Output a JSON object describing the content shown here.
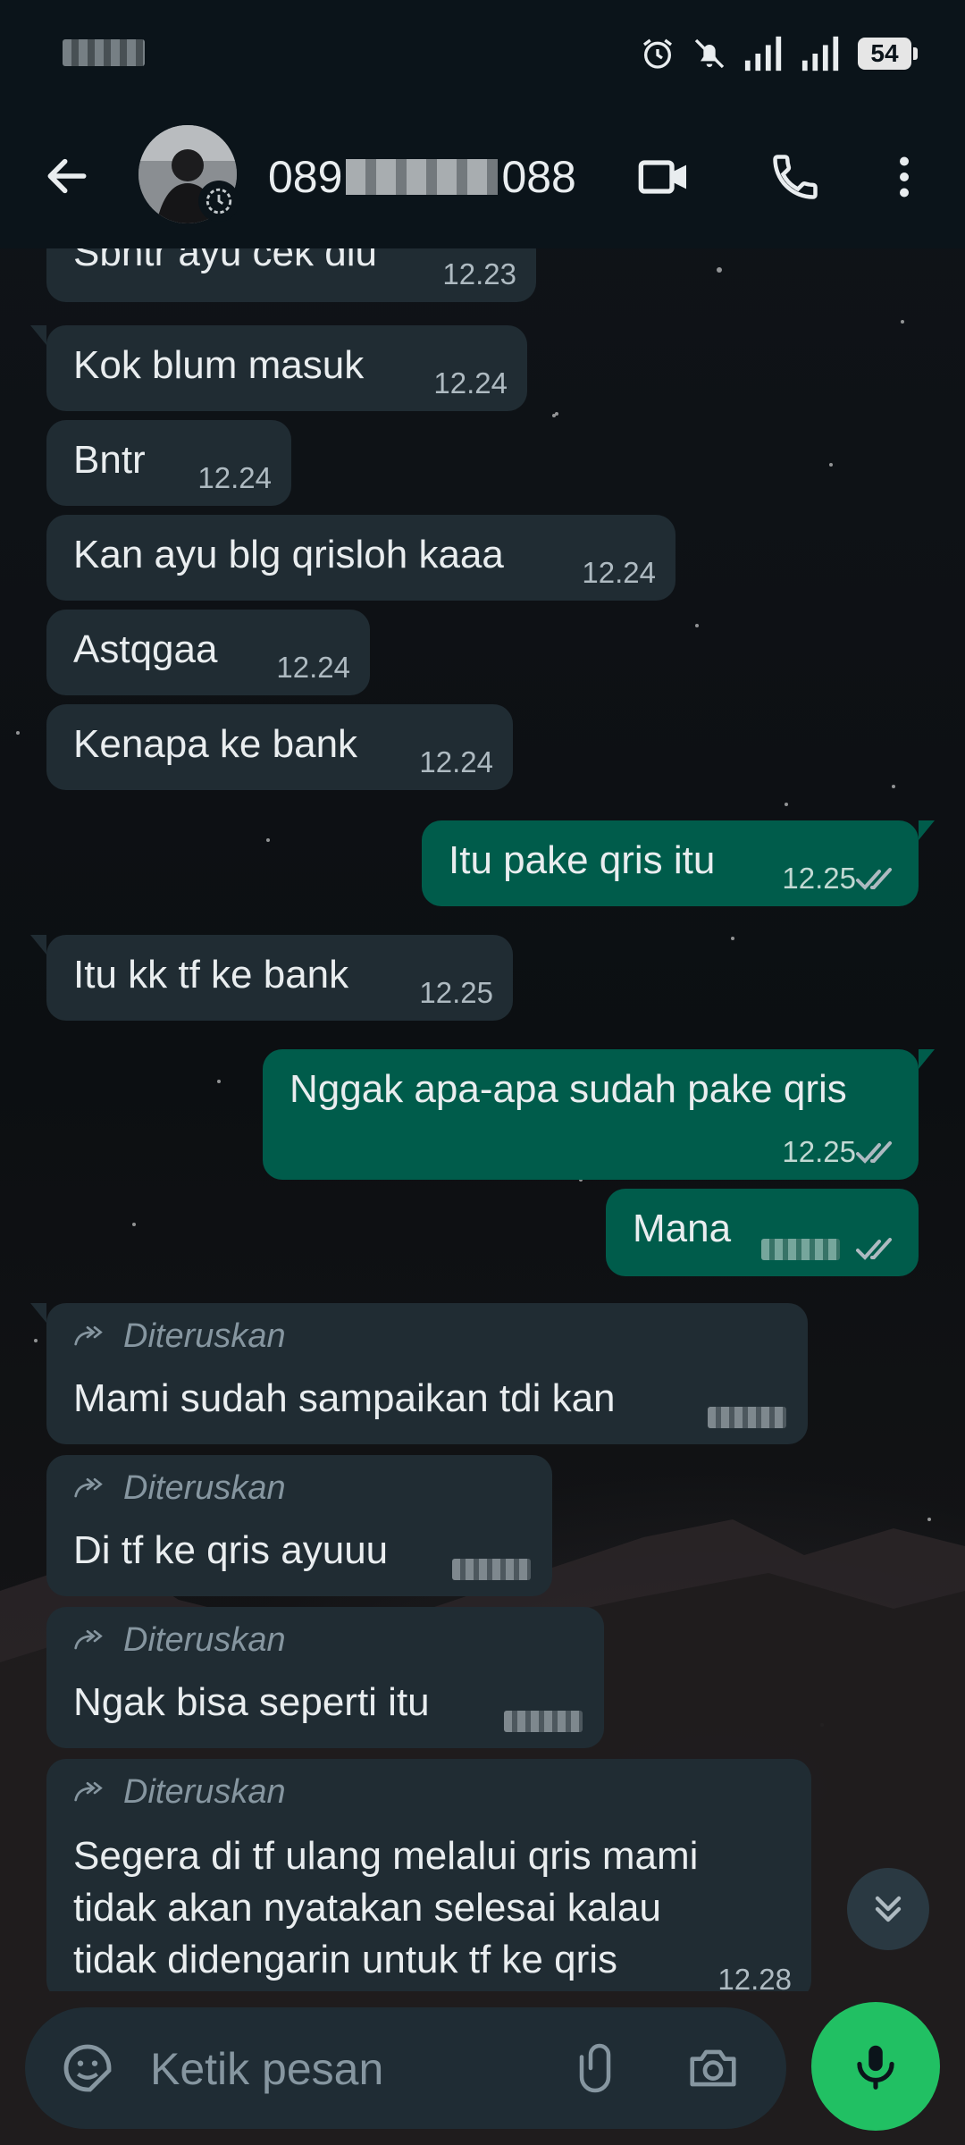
{
  "status_bar": {
    "battery": "54"
  },
  "header": {
    "contact_prefix": "089",
    "contact_suffix": "088",
    "back_icon": "arrow-left-icon",
    "video_icon": "videocam-icon",
    "call_icon": "phone-icon",
    "menu_icon": "more-vert-icon"
  },
  "messages": [
    {
      "dir": "in",
      "text": "Sbntr ayu cek dlu",
      "time": "12.23"
    },
    {
      "dir": "in",
      "text": "Kok blum masuk",
      "time": "12.24"
    },
    {
      "dir": "in",
      "text": "Bntr",
      "time": "12.24"
    },
    {
      "dir": "in",
      "text": "Kan ayu blg qrisloh kaaa",
      "time": "12.24"
    },
    {
      "dir": "in",
      "text": "Astqgaa",
      "time": "12.24"
    },
    {
      "dir": "in",
      "text": "Kenapa ke bank",
      "time": "12.24"
    },
    {
      "dir": "out",
      "text": "Itu pake qris itu",
      "time": "12.25"
    },
    {
      "dir": "in",
      "text": "Itu kk tf ke bank",
      "time": "12.25"
    },
    {
      "dir": "out",
      "text": "Nggak apa-apa sudah pake qris",
      "time": "12.25"
    },
    {
      "dir": "out",
      "text": "Mana",
      "time": ""
    },
    {
      "dir": "in",
      "forwarded": "Diteruskan",
      "text": "Mami sudah sampaikan tdi kan",
      "time": ""
    },
    {
      "dir": "in",
      "forwarded": "Diteruskan",
      "text": "Di tf ke qris ayuuu",
      "time": ""
    },
    {
      "dir": "in",
      "forwarded": "Diteruskan",
      "text": "Ngak bisa seperti itu",
      "time": ""
    },
    {
      "dir": "in",
      "forwarded": "Diteruskan",
      "text": "Segera di tf ulang melalui qris mami\ntidak akan nyatakan selesai kalau\ntidak didengarin untuk tf ke qris",
      "time": "12.28"
    }
  ],
  "input": {
    "placeholder": "Ketik pesan"
  },
  "colors": {
    "incoming": "#202c33",
    "outgoing": "#005c4b",
    "mic": "#21c063",
    "header": "#0b141a"
  }
}
